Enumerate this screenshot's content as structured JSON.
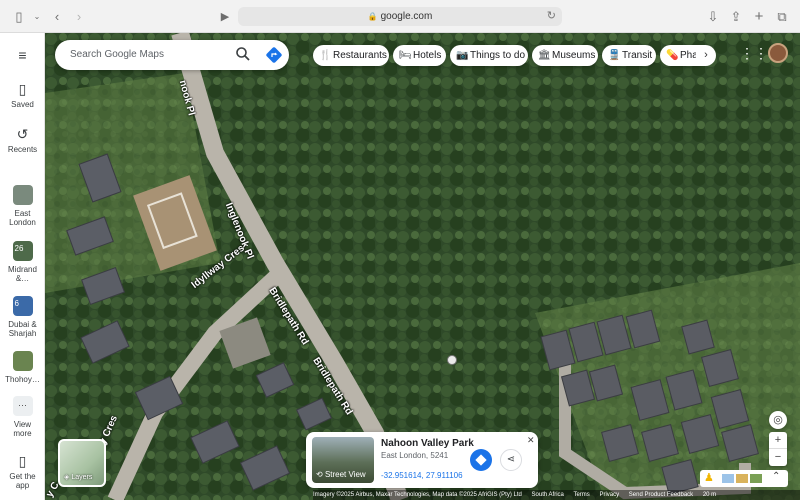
{
  "browser": {
    "url": "google.com"
  },
  "search": {
    "placeholder": "Search Google Maps"
  },
  "chips": [
    {
      "label": "Restaurants",
      "icon": "fork-knife-icon"
    },
    {
      "label": "Hotels",
      "icon": "bed-icon"
    },
    {
      "label": "Things to do",
      "icon": "camera-icon"
    },
    {
      "label": "Museums",
      "icon": "museum-icon"
    },
    {
      "label": "Transit",
      "icon": "train-icon"
    },
    {
      "label": "Pha",
      "icon": "pharmacy-icon"
    }
  ],
  "rail": {
    "saved": "Saved",
    "recents": "Recents",
    "places": [
      {
        "label1": "East",
        "label2": "London",
        "num": "",
        "color": "#7a8a7d"
      },
      {
        "label1": "Midrand",
        "label2": "&…",
        "num": "26",
        "color": "#4e6a4a"
      },
      {
        "label1": "Dubai &",
        "label2": "Sharjah",
        "num": "6",
        "color": "#3b6aa8"
      },
      {
        "label1": "Thohoy…",
        "label2": "",
        "num": "",
        "color": "#6a8450"
      }
    ],
    "view_more1": "View",
    "view_more2": "more",
    "get_app1": "Get the",
    "get_app2": "app"
  },
  "map": {
    "roads": [
      {
        "label": "Inglenook Pl"
      },
      {
        "label": "Idyllway Cres"
      },
      {
        "label": "Bridlepath Rd"
      },
      {
        "label": "Bridlepath Rd"
      },
      {
        "label": "Idyllway Cres"
      },
      {
        "label": "nook Pl"
      },
      {
        "label": "y C"
      }
    ]
  },
  "card": {
    "title": "Nahoon Valley Park",
    "address": "East London, 5241",
    "coordinates": "-32.951614, 27.911106",
    "street_view": "Street View"
  },
  "layers": {
    "label": "Layers"
  },
  "footer": {
    "imagery": "Imagery ©2025 Airbus, Maxar Technologies, Map data ©2025 AfriGIS (Pty) Ltd",
    "country": "South Africa",
    "terms": "Terms",
    "privacy": "Privacy",
    "feedback": "Send Product Feedback",
    "scale": "20 m"
  },
  "colors": {
    "accent": "#1a73e8"
  }
}
